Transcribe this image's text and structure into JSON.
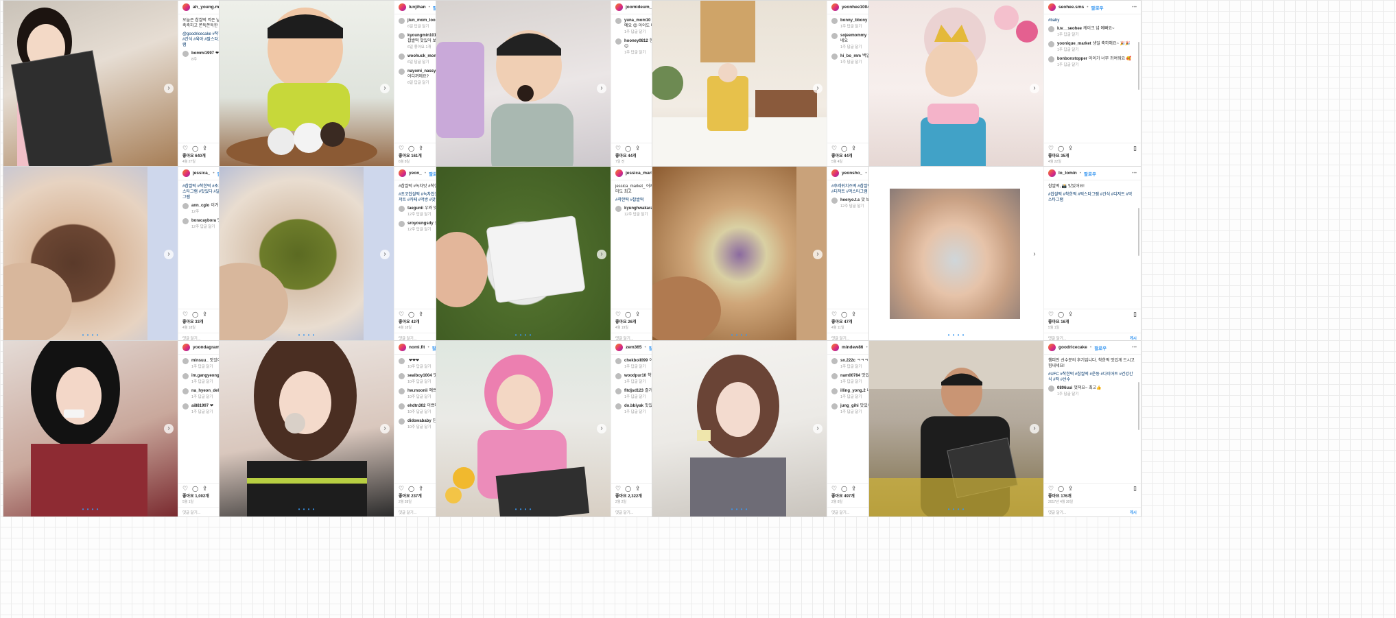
{
  "ui": {
    "follow": "팔로우",
    "reply": "답글 달기",
    "add_comment": "댓글 달기...",
    "post": "게시",
    "more": "•••"
  },
  "posts": [
    {
      "user": "ah_young.mom",
      "caption": "오늘은 찹쌀떡 먹은 날❤ 딸아이가 너무 좋아해요. 촉촉하고 쫀득쫀득한 떡 맛있게 잘 먹었습니다😋",
      "hashtags": "@goodricecake #착한떡 #마미스타그램 #찹쌀떡 #간식 #육아 #딸스타그램 #떡스타그램 #맛스타그램",
      "comments": [
        {
          "user": "bommi1997",
          "text": "❤❤❤",
          "meta": "8주"
        }
      ],
      "likes": "좋아요 640개",
      "date": "4월 27일",
      "photo": {
        "bg": "linear-gradient(160deg,#c9c2b8 0%,#e6ddd3 40%,#a1764c 100%)",
        "subject": "girl"
      }
    },
    {
      "user": "luvjihan",
      "caption": "",
      "hashtags": "",
      "comments": [
        {
          "user": "jiun_mom_loo",
          "text": "ㅋㅋㅋ 너무 귀엽다🤣",
          "meta": "6일 답글 달기"
        },
        {
          "user": "kyoungmin1019",
          "text": "진짜 행복한 표정이네요~ 찹쌀떡 맛있어 보여요",
          "meta": "6일 좋아요 1개"
        },
        {
          "user": "woohuck_mom",
          "text": "와 넘 맛있겠어요 👍👍👍",
          "meta": "6일 답글 달기"
        },
        {
          "user": "nayomi_nassy",
          "text": "먹고 싶다~ 쫀득쫀득 이거 어디꺼에요?",
          "meta": "6일 답글 달기"
        }
      ],
      "likes": "좋아요 161개",
      "date": "6월 8일",
      "photo": {
        "bg": "linear-gradient(180deg,#eef0ea 0%,#dfe3dc 55%,#8b5a34 100%)",
        "subject": "boy"
      }
    },
    {
      "user": "joomideum_mom",
      "caption": "",
      "hashtags": "",
      "comments": [
        {
          "user": "yuna_mom10",
          "text": "와 진짜 맛있어 보여요 ~ 최고예요 😍 아이도 너무 좋아하네요",
          "meta": "1주 답글 달기"
        },
        {
          "user": "hooney0812",
          "text": "한 입 먹고 싶어요 너무 귀엽다 😊",
          "meta": "1주 답글 달기"
        }
      ],
      "likes": "좋아요 44개",
      "date": "7일 전",
      "photo": {
        "bg": "linear-gradient(170deg,#d7d2cf 0%,#ebe6e6 50%,#c9c4c9 100%)",
        "subject": "toddler"
      }
    },
    {
      "user": "yeonhee1004",
      "caption": "",
      "hashtags": "",
      "comments": [
        {
          "user": "bonny_bbony",
          "text": "예뻐요❤❤",
          "meta": "1주 답글 달기"
        },
        {
          "user": "sojeemommy",
          "text": "축하드려요 💐💐 너무 이쁘네요",
          "meta": "1주 답글 달기"
        },
        {
          "user": "hi_bo_mm",
          "text": "백일상 너무 예뻐요❤",
          "meta": "1주 답글 달기"
        }
      ],
      "likes": "좋아요 44개",
      "date": "5월 4일",
      "photo": {
        "bg": "linear-gradient(180deg,#e9e2d6 0%,#f2ece4 60%,#d9cfbf 100%)",
        "subject": "party"
      }
    },
    {
      "user": "seohee.sms",
      "caption": "",
      "hashtags": "#baby",
      "comments": [
        {
          "user": "luv__seohee",
          "text": "케이크 넘 예뻐요~",
          "meta": "1주 답글 달기"
        },
        {
          "user": "yoonique_market",
          "text": "생일 축하해요~ 🎉🎉",
          "meta": "1주 답글 달기"
        },
        {
          "user": "bonbonstopper",
          "text": "아이가 너무 귀여워요 🥰",
          "meta": "1주 답글 달기"
        }
      ],
      "likes": "좋아요 35개",
      "date": "4월 22일",
      "photo": {
        "bg": "linear-gradient(180deg,#f1e6e3 0%,#f7efed 50%,#e3d4d0 100%)",
        "subject": "birthday"
      }
    },
    {
      "user": "jessica_",
      "caption": "",
      "hashtags": "#찹쌀떡 #착한떡 #초코찹쌀떡 #간식스타그램 #떡스타그램 #맛있다 #달달하다 #오늘의간식 #먹스타그램",
      "comments": [
        {
          "user": "ann_cglo",
          "text": "이거 좋아요😍",
          "meta": "12주"
        },
        {
          "user": "boracaybora",
          "text": "맛있겠다~",
          "meta": "12주 답글 달기"
        }
      ],
      "likes": "좋아요 33개",
      "date": "4월 18일",
      "photo": {
        "bg": "radial-gradient(ellipse at 40% 55%,#5a3a2a 0%,#6b4633 28%,#d9b89c 29%,#e7d3c1 60%,#b6c1dd 100%)",
        "subject": "cake"
      }
    },
    {
      "user": "yeon_",
      "caption": "#찹쌀떡 #녹차맛 #착한떡 쫀득쫀득 맛있어요👍",
      "hashtags": "#초코찹쌀떡 #녹차찹쌀떡 #간식 #맛있다 #떡 #디저트 #카페 #먹방 #맛집",
      "comments": [
        {
          "user": "taegunii",
          "text": "우와 맛있겠다",
          "meta": "12주 답글 달기"
        },
        {
          "user": "sroyoungsdy",
          "text": "쫀득쫀득~",
          "meta": "12주 답글 달기"
        }
      ],
      "likes": "좋아요 42개",
      "date": "4월 18일",
      "photo": {
        "bg": "radial-gradient(ellipse at 45% 50%,#5b6a22 0%,#6e7d2b 28%,#d7c2ad 29%,#e9ddd0 60%,#aab6d6 100%)",
        "subject": "cake"
      }
    },
    {
      "user": "jessica_market_",
      "caption": "jessica_market_ 어제 받은 떡 너무 맛있어요 인절미도 최고",
      "hashtags": "#착한떡 #찹쌀떡",
      "comments": [
        {
          "user": "kyunghwakarakas",
          "text": "우와 좋아요~",
          "meta": "12주 답글 달기"
        }
      ],
      "likes": "좋아요 26개",
      "date": "4월 19일",
      "photo": {
        "bg": "radial-gradient(ellipse at 50% 55%,#f4f4f4 0%,#e8e8e8 30%,#4f6e2c 31%,#3e5a22 100%)",
        "subject": "pack"
      }
    },
    {
      "user": "yeonsho_",
      "caption": "",
      "hashtags": "#후레쉬치즈떡 #찹쌀떡 #오늘의간식 #착한떡 #떡 #디저트 #먹스타그램 #맛스타그램",
      "comments": [
        {
          "user": "heeryo.t.s",
          "text": "맛 보고 가요 📸",
          "meta": "12주 답글 달기"
        }
      ],
      "likes": "좋아요 47개",
      "date": "4월 11일",
      "photo": {
        "bg": "radial-gradient(ellipse at 50% 50%,#8b6aa0 0%,#d9d0a3 22%,#cfa679 40%,#8b5a2f 100%)",
        "subject": "cheese"
      }
    },
    {
      "user": "lo_lomin",
      "caption": "찹쌀떡, 📸 맛있어요!",
      "hashtags": "#찹쌀떡 #착한떡 #떡스타그램 #간식 #디저트 #먹스타그램",
      "comments": [],
      "likes": "좋아요 16개",
      "date": "5월 1일",
      "photo": {
        "bg": "#ffffff",
        "subject": "hand"
      }
    },
    {
      "user": "yoondagramm_",
      "caption": "",
      "hashtags": "",
      "comments": [
        {
          "user": "minsuu_",
          "text": "맛있어 보여요❤",
          "meta": "1주 답글 달기"
        },
        {
          "user": "im.gangyeong",
          "text": "🤩🤩🤩",
          "meta": "1주 답글 달기"
        },
        {
          "user": "na_hyeon_dell",
          "text": "👍",
          "meta": "1주 답글 달기"
        },
        {
          "user": "ai881997",
          "text": "❤",
          "meta": "1주 답글 달기"
        }
      ],
      "likes": "좋아요 1,002개",
      "date": "5월 1일",
      "photo": {
        "bg": "linear-gradient(160deg,#e4dbd6 0%,#c9a89c 55%,#7a2a2f 100%)",
        "subject": "woman"
      }
    },
    {
      "user": "nomi.fit",
      "caption": "",
      "hashtags": "",
      "comments": [
        {
          "user": "",
          "text": "❤❤❤",
          "meta": "10주 답글 달기"
        },
        {
          "user": "sealboy1004",
          "text": "맛있겠다~",
          "meta": "10주 답글 달기"
        },
        {
          "user": "hw.moonii",
          "text": "예쁘다!",
          "meta": "10주 답글 달기"
        },
        {
          "user": "ehdtn302",
          "text": "이쁘다😊",
          "meta": "10주 답글 달기"
        },
        {
          "user": "didowababy",
          "text": "진짜 귀엽다 예쁘다 👍",
          "meta": "10주 답글 달기"
        }
      ],
      "likes": "좋아요 237개",
      "date": "2월 28일",
      "photo": {
        "bg": "linear-gradient(170deg,#ece6e2 0%,#d9c7bd 55%,#2b2b2b 100%)",
        "subject": "woman2"
      }
    },
    {
      "user": "zem365",
      "caption": "",
      "hashtags": "",
      "comments": [
        {
          "user": "chekboil099",
          "text": "아 정말 귀엽다 😍",
          "meta": "1주 답글 달기"
        },
        {
          "user": "woodpur10",
          "text": "착한떡 맛있어요",
          "meta": "1주 답글 달기"
        },
        {
          "user": "fitdjsd123",
          "text": "즐거운 간식시간",
          "meta": "1주 답글 달기"
        },
        {
          "user": "do.bbiyak",
          "text": "맛있겠다!",
          "meta": "1주 답글 달기"
        }
      ],
      "likes": "좋아요 2,322개",
      "date": "2월 2일",
      "photo": {
        "bg": "linear-gradient(180deg,#dfe7e0 0%,#eaeae6 45%,#d8cfc4 100%)",
        "subject": "kid"
      }
    },
    {
      "user": "mindew86",
      "caption": "",
      "hashtags": "",
      "comments": [
        {
          "user": "sn.222c",
          "text": "ㅋㅋㅋ 넘나 좋아요 😆",
          "meta": "1주 답글 달기"
        },
        {
          "user": "nam00784",
          "text": "맛있어 보여요❤",
          "meta": "1주 답글 달기"
        },
        {
          "user": "illing_yong.2",
          "text": "나도 먹고 싶다",
          "meta": "1주 답글 달기"
        },
        {
          "user": "jung_gihi",
          "text": "맛있어요~",
          "meta": "1주 답글 달기"
        }
      ],
      "likes": "좋아요 497개",
      "date": "2월 8일",
      "photo": {
        "bg": "linear-gradient(170deg,#f4f3f0 0%,#eceae6 50%,#c9c4bd 100%)",
        "subject": "woman3"
      }
    },
    {
      "user": "goodricecake",
      "caption": "챔피언 선수분의 후기입니다. 착한떡 맛있게 드시고 힘내세요!",
      "hashtags": "#UFC #착한떡 #찹쌀떡 #운동 #다이어트 #건강간식 #떡 #선수",
      "comments": [
        {
          "user": "0806uui",
          "text": "멋져요~ 최고👍",
          "meta": "1주 답글 달기"
        }
      ],
      "likes": "좋아요 176개",
      "date": "2017년 4월 30일",
      "photo": {
        "bg": "linear-gradient(180deg,#c8bfb2 0%,#b4aa9d 45%,#7d6e4a 100%)",
        "subject": "man"
      }
    }
  ]
}
